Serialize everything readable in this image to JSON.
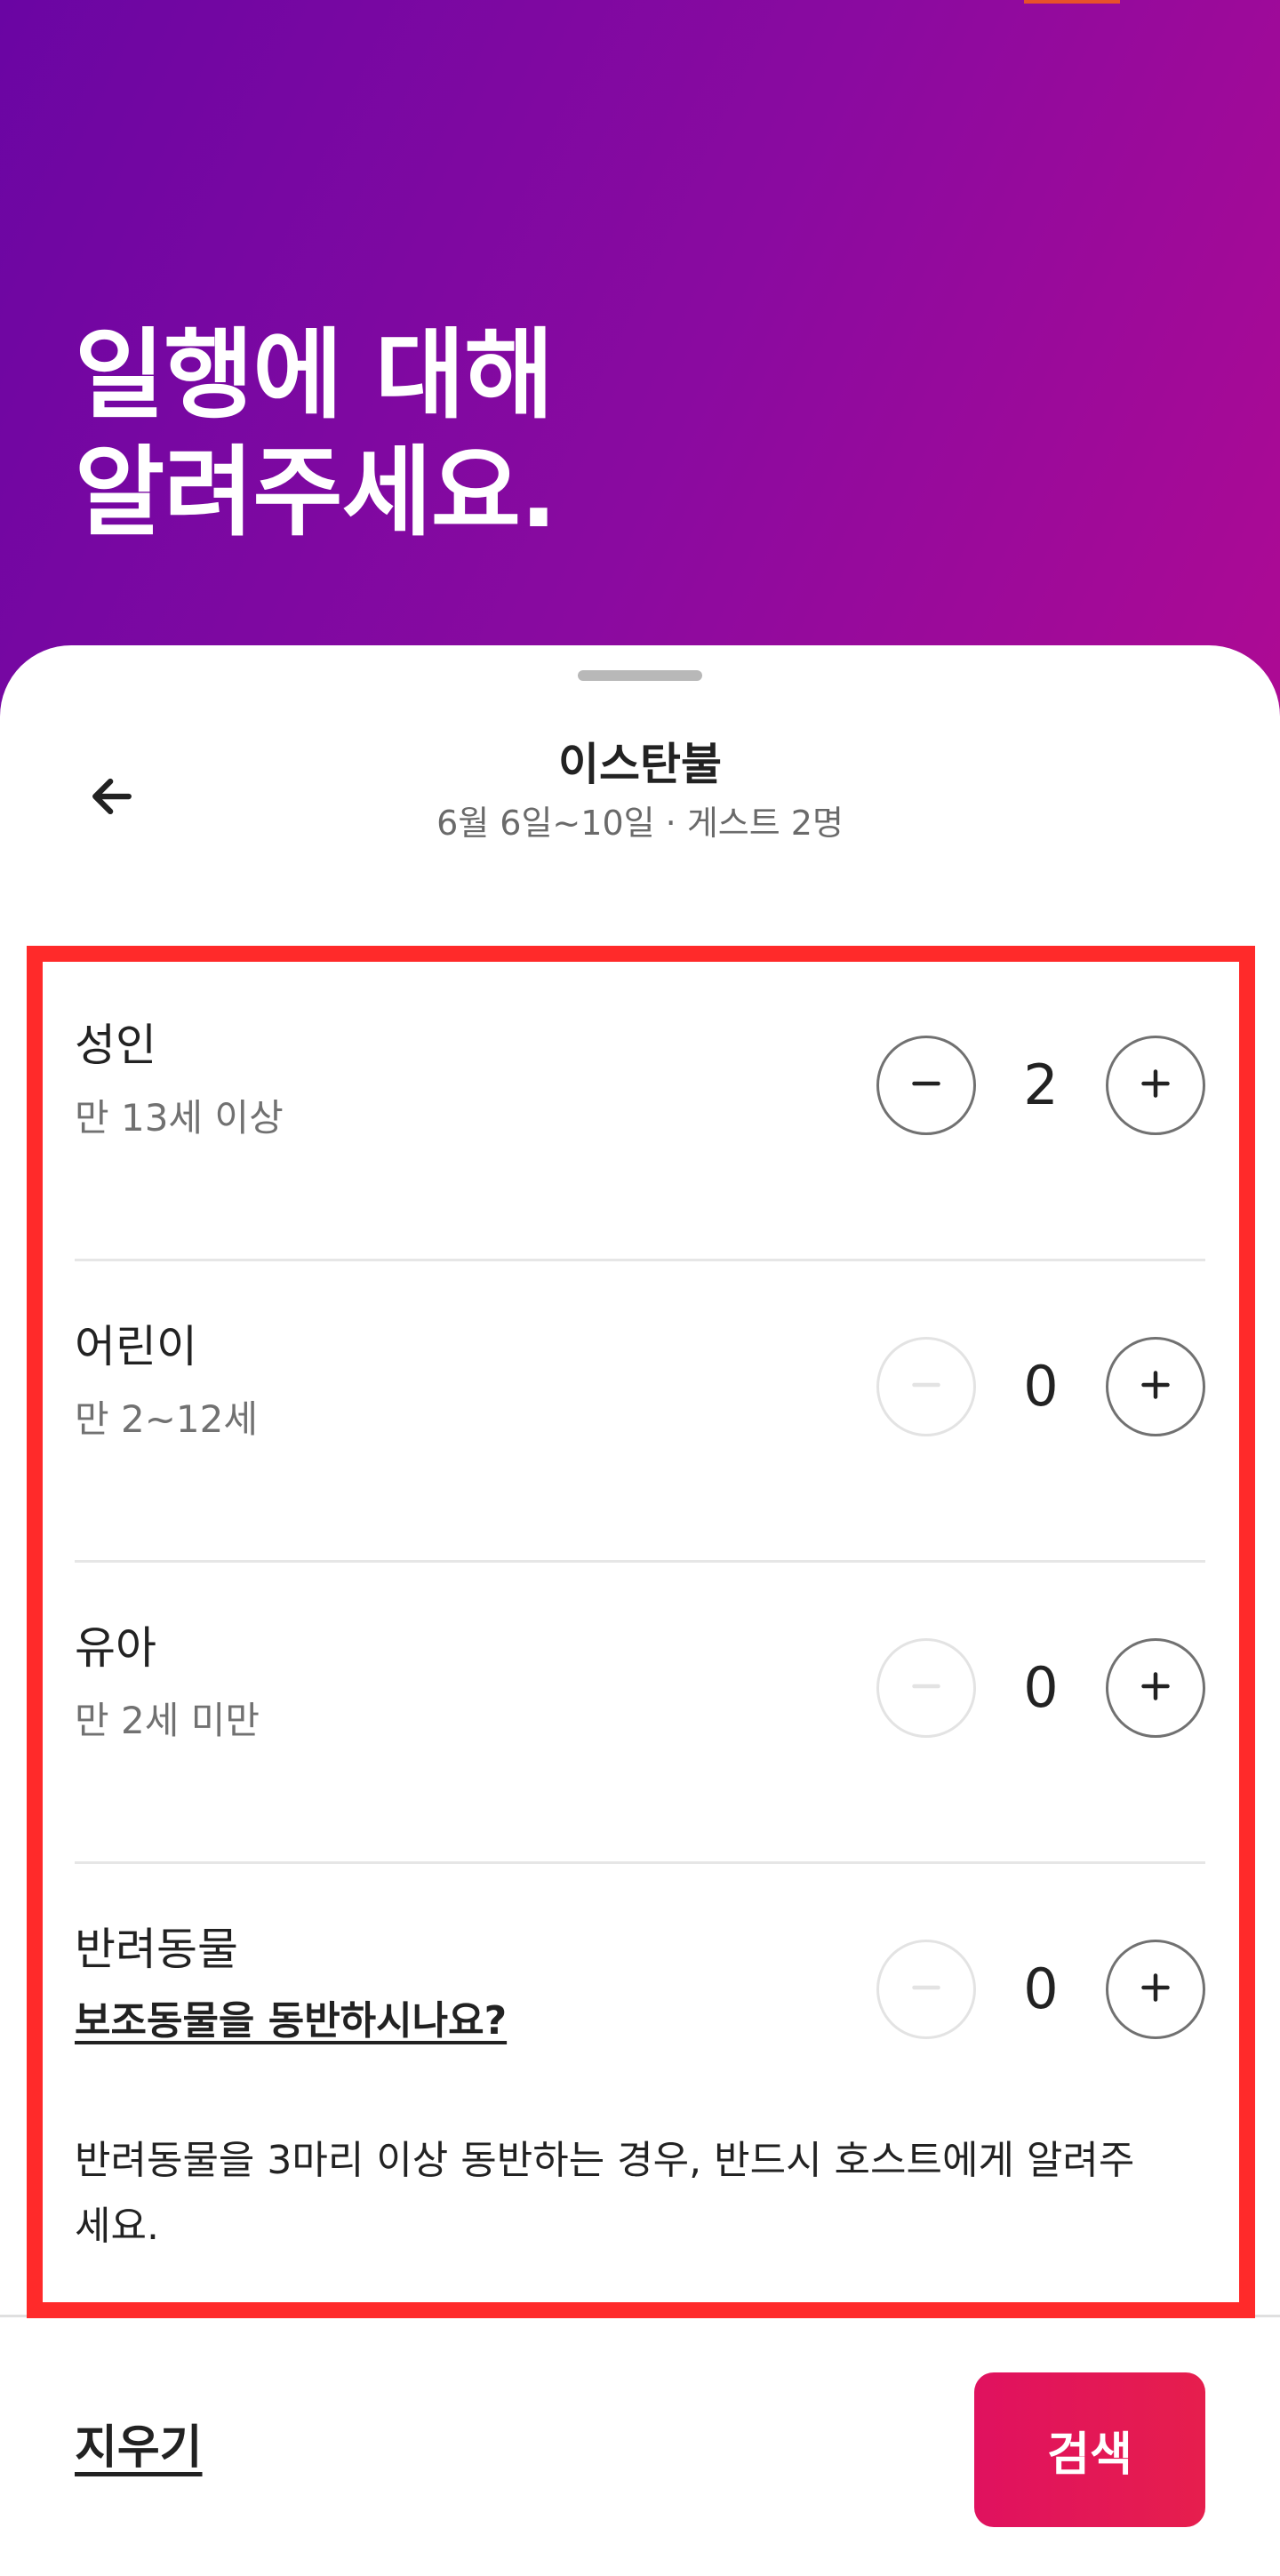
{
  "hero": {
    "title": "일행에 대해\n알려주세요."
  },
  "header": {
    "title": "이스탄불",
    "subtitle": "6월 6일~10일 · 게스트 2명"
  },
  "guests": [
    {
      "label": "성인",
      "sublabel": "만 13세 이상",
      "count": "2",
      "decrement_enabled": true,
      "increment_enabled": true
    },
    {
      "label": "어린이",
      "sublabel": "만 2~12세",
      "count": "0",
      "decrement_enabled": false,
      "increment_enabled": true
    },
    {
      "label": "유아",
      "sublabel": "만 2세 미만",
      "count": "0",
      "decrement_enabled": false,
      "increment_enabled": true
    },
    {
      "label": "반려동물",
      "link": "보조동물을 동반하시나요?",
      "count": "0",
      "decrement_enabled": false,
      "increment_enabled": true
    }
  ],
  "pets_notice": "반려동물을 3마리 이상 동반하는 경우, 반드시 호스트에게 알려주세요.",
  "footer": {
    "clear_label": "지우기",
    "search_label": "검색"
  },
  "icons": {
    "back": "arrow-left-icon",
    "minus": "minus-icon",
    "plus": "plus-icon"
  },
  "colors": {
    "hero_gradient_start": "#6a05a3",
    "hero_gradient_end": "#cc0c7e",
    "search_button": "#e61e4d",
    "highlight_border": "#ff2a2a",
    "stepper_disabled": "#e3e3e3"
  }
}
